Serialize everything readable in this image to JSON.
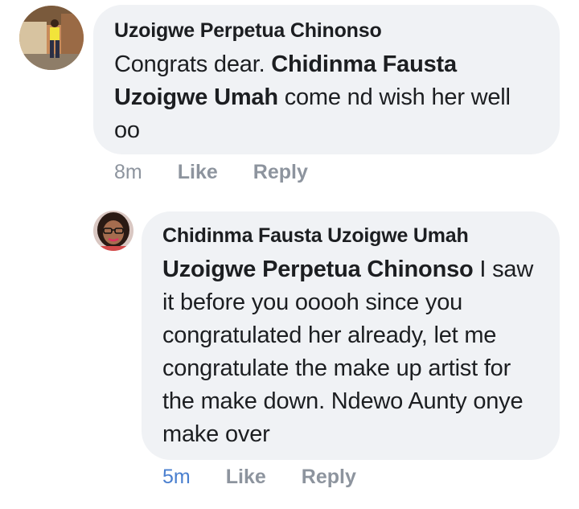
{
  "comments": [
    {
      "author": "Uzoigwe Perpetua Chinonso",
      "text_plain_1": "Congrats dear. ",
      "mention": "Chidinma Fausta Uzoigwe Umah",
      "text_plain_2": " come nd wish her well oo",
      "time": "8m",
      "like_label": "Like",
      "reply_label": "Reply"
    },
    {
      "author": "Chidinma Fausta Uzoigwe Umah",
      "mention": "Uzoigwe Perpetua Chinonso",
      "text_plain": " I saw it before you ooooh  since you congratulated her already, let me congratulate the make up artist for the make down. Ndewo Aunty onye make over",
      "time": "5m",
      "like_label": "Like",
      "reply_label": "Reply"
    }
  ],
  "colors": {
    "bubble": "#f0f2f5",
    "text": "#1c1e21",
    "meta": "#8d949e",
    "recent_time": "#4a7fcf"
  }
}
